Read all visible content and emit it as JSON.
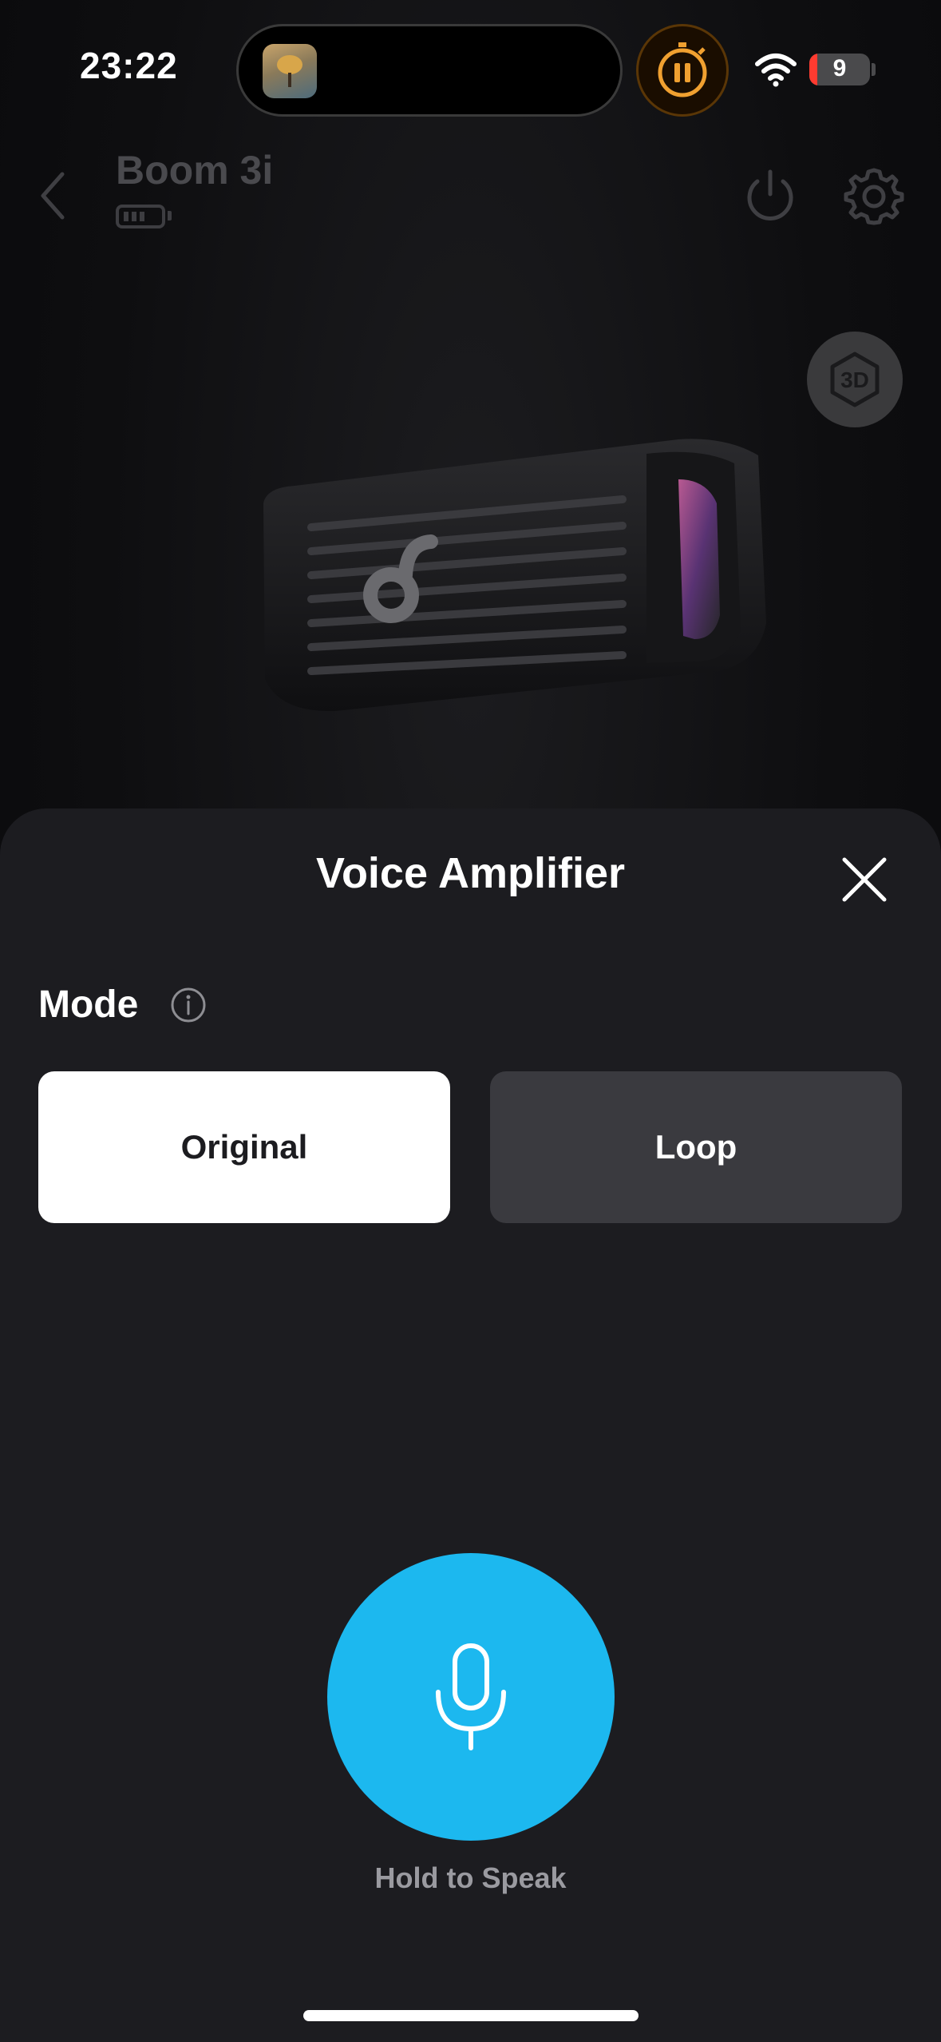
{
  "status_bar": {
    "time": "23:22",
    "battery_level": "9",
    "wifi": "wifi-icon",
    "now_playing_icon": "album-art-icon",
    "timer_icon": "pause-timer-icon",
    "accent_timer": "#f0a030",
    "battery_low_color": "#ff3b30"
  },
  "device": {
    "name": "Boom 3i",
    "battery_bars": 3,
    "back_icon": "chevron-left-icon",
    "power_icon": "power-icon",
    "settings_icon": "gear-icon",
    "view_3d_icon": "3d-view-icon"
  },
  "sheet": {
    "title": "Voice Amplifier",
    "close_icon": "close-icon",
    "mode_label": "Mode",
    "info_icon": "info-icon",
    "modes": [
      {
        "label": "Original",
        "selected": true
      },
      {
        "label": "Loop",
        "selected": false
      }
    ],
    "mic_icon": "microphone-icon",
    "hold_label": "Hold to Speak",
    "accent": "#1cb8ef"
  }
}
